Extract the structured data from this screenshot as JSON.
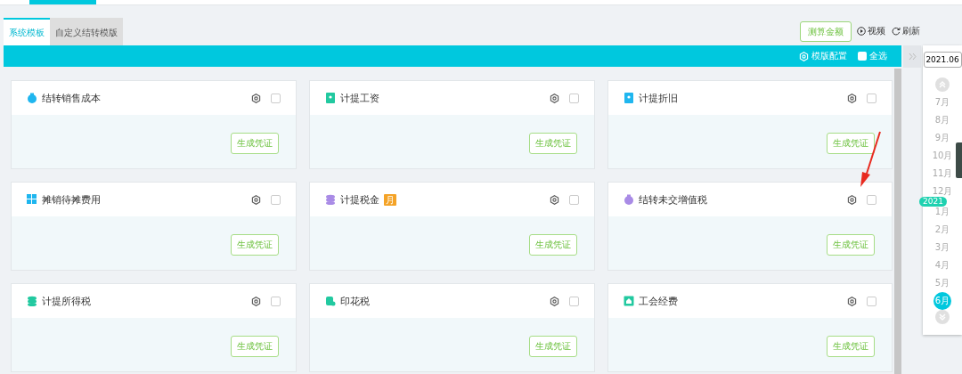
{
  "tabs": [
    {
      "label": "系统模板",
      "selected": true
    },
    {
      "label": "自定义结转模版",
      "selected": false
    }
  ],
  "toolbar": {
    "calc_button": "测算金额",
    "video_link": "视频",
    "refresh_link": "刷新"
  },
  "banner": {
    "config_link": "模版配置",
    "select_all": {
      "label": "全选",
      "checked": false
    }
  },
  "cards": [
    {
      "title": "结转销售成本",
      "kind": "bag",
      "color": "#1fb6ef",
      "checked": false,
      "action": "生成凭证"
    },
    {
      "title": "计提工资",
      "kind": "badge",
      "color": "#22c9a0",
      "checked": false,
      "action": "生成凭证"
    },
    {
      "title": "计提折旧",
      "kind": "badge",
      "color": "#1fb6ef",
      "checked": false,
      "action": "生成凭证"
    },
    {
      "title": "摊销待摊费用",
      "kind": "grid",
      "color": "#1fb6ef",
      "checked": false,
      "action": "生成凭证"
    },
    {
      "title": "计提税金",
      "kind": "stack",
      "color": "#a98be6",
      "checked": false,
      "action": "生成凭证",
      "tag": "月"
    },
    {
      "title": "结转未交增值税",
      "kind": "bag",
      "color": "#a98be6",
      "checked": false,
      "action": "生成凭证"
    },
    {
      "title": "计提所得税",
      "kind": "stack",
      "color": "#22c9a0",
      "checked": false,
      "action": "生成凭证"
    },
    {
      "title": "印花税",
      "kind": "cylinder",
      "color": "#22c9a0",
      "checked": false,
      "action": "生成凭证"
    },
    {
      "title": "工会经费",
      "kind": "house",
      "color": "#22c9a0",
      "checked": false,
      "action": "生成凭证"
    }
  ],
  "calendar": {
    "period": "2021.06",
    "months": [
      {
        "label": "7月",
        "selected": false
      },
      {
        "label": "8月",
        "selected": false
      },
      {
        "label": "9月",
        "selected": false
      },
      {
        "label": "10月",
        "selected": false
      },
      {
        "label": "11月",
        "selected": false
      },
      {
        "label": "12月",
        "selected": false
      },
      {
        "label": "1月",
        "selected": false,
        "year_badge": "2021"
      },
      {
        "label": "2月",
        "selected": false
      },
      {
        "label": "3月",
        "selected": false
      },
      {
        "label": "4月",
        "selected": false
      },
      {
        "label": "5月",
        "selected": false
      },
      {
        "label": "6月",
        "selected": true
      }
    ]
  }
}
